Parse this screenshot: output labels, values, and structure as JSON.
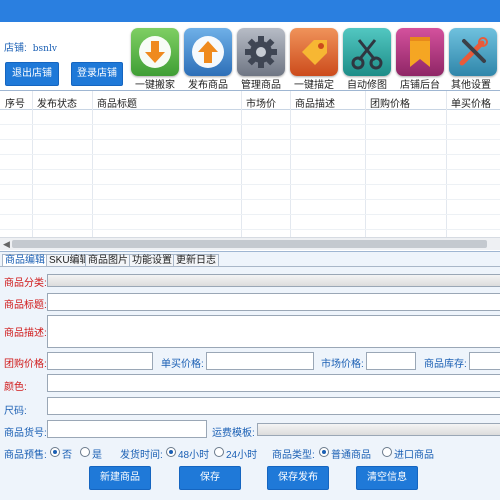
{
  "header": {
    "store_label": "店铺:",
    "store_name": "bsnlv",
    "logout_button": "退出店铺",
    "login_button": "登录店铺"
  },
  "toolbar": [
    {
      "label": "一键搬家",
      "icon": "download-arrow-icon",
      "color": "#4caf50"
    },
    {
      "label": "发布商品",
      "icon": "upload-arrow-icon",
      "color": "#3d82c4"
    },
    {
      "label": "管理商品",
      "icon": "gear-icon",
      "color": "#8d96a6"
    },
    {
      "label": "一键描定",
      "icon": "price-tag-icon",
      "color": "#e8702c"
    },
    {
      "label": "自动修图",
      "icon": "scissors-icon",
      "color": "#26a7a1"
    },
    {
      "label": "店铺后台",
      "icon": "bookmark-ribbon-icon",
      "color": "#b5347f"
    },
    {
      "label": "其他设置",
      "icon": "tools-icon",
      "color": "#4aa7c7"
    }
  ],
  "table": {
    "columns": [
      "序号",
      "发布状态",
      "商品标题",
      "市场价",
      "商品描述",
      "团购价格",
      "单买价格"
    ]
  },
  "tabs": [
    "商品编辑",
    "SKU编辑",
    "商品图片",
    "功能设置",
    "更新日志"
  ],
  "form": {
    "category": "商品分类:",
    "title": "商品标题:",
    "description": "商品描述:",
    "group_price": "团购价格:",
    "single_price": "单买价格:",
    "market_price": "市场价格:",
    "stock": "商品库存:",
    "color": "颜色:",
    "size": "尺码:",
    "item_code": "商品货号:",
    "shipping_template": "运费模板:",
    "presale_label": "商品预售:",
    "presale_options": [
      "否",
      "是"
    ],
    "ship_time_label": "发货时间:",
    "ship_time_options": [
      "48小时",
      "24小时"
    ],
    "type_label": "商品类型:",
    "type_options": [
      "普通商品",
      "进口商品"
    ]
  },
  "actions": [
    "新建商品",
    "保存",
    "保存发布",
    "清空信息"
  ]
}
